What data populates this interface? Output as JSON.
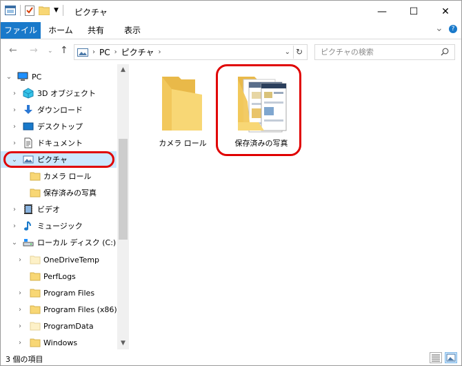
{
  "window": {
    "title": "ピクチャ",
    "minimize_glyph": "—",
    "maximize_glyph": "☐",
    "close_glyph": "✕"
  },
  "ribbon": {
    "tabs": [
      "ファイル",
      "ホーム",
      "共有",
      "表示"
    ],
    "expand_glyph": "⌄",
    "help_glyph": "?"
  },
  "address": {
    "crumbs": [
      "PC",
      "ピクチャ"
    ],
    "search_placeholder": "ピクチャの検索"
  },
  "nav": {
    "items": [
      {
        "label": "PC",
        "icon": "computer-icon"
      },
      {
        "label": "3D オブジェクト",
        "icon": "3d-objects-icon"
      },
      {
        "label": "ダウンロード",
        "icon": "download-icon"
      },
      {
        "label": "デスクトップ",
        "icon": "desktop-icon"
      },
      {
        "label": "ドキュメント",
        "icon": "document-icon"
      },
      {
        "label": "ピクチャ",
        "icon": "pictures-icon"
      },
      {
        "label": "カメラ ロール",
        "icon": "folder-icon"
      },
      {
        "label": "保存済みの写真",
        "icon": "folder-icon"
      },
      {
        "label": "ビデオ",
        "icon": "video-icon"
      },
      {
        "label": "ミュージック",
        "icon": "music-icon"
      },
      {
        "label": "ローカル ディスク (C:)",
        "icon": "drive-icon"
      },
      {
        "label": "OneDriveTemp",
        "icon": "folder-icon"
      },
      {
        "label": "PerfLogs",
        "icon": "folder-icon"
      },
      {
        "label": "Program Files",
        "icon": "folder-icon"
      },
      {
        "label": "Program Files (x86)",
        "icon": "folder-icon"
      },
      {
        "label": "ProgramData",
        "icon": "folder-icon"
      },
      {
        "label": "Windows",
        "icon": "folder-icon"
      }
    ]
  },
  "content": {
    "items": [
      {
        "label": "カメラ ロール",
        "icon": "folder-icon"
      },
      {
        "label": "保存済みの写真",
        "icon": "folder-with-pictures-icon"
      }
    ]
  },
  "status": {
    "item_count": "3 個の項目"
  },
  "colors": {
    "accent": "#1979ca",
    "selection": "#cce8ff",
    "highlight": "#e00000",
    "folder": "#f8d775"
  }
}
